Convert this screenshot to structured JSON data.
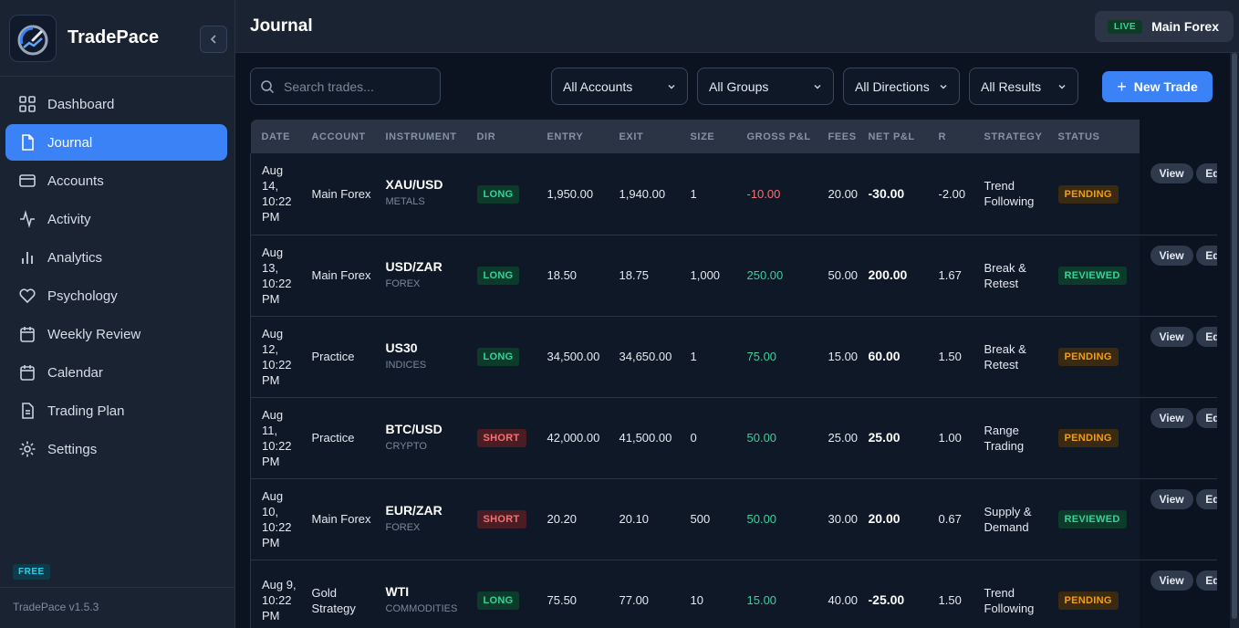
{
  "app": {
    "name": "TradePace",
    "version": "TradePace v1.5.3",
    "plan": "FREE"
  },
  "sidebar": {
    "items": [
      {
        "label": "Dashboard",
        "icon": "grid-icon"
      },
      {
        "label": "Journal",
        "icon": "document-icon",
        "active": true
      },
      {
        "label": "Accounts",
        "icon": "card-icon"
      },
      {
        "label": "Activity",
        "icon": "pulse-icon"
      },
      {
        "label": "Analytics",
        "icon": "bar-chart-icon"
      },
      {
        "label": "Psychology",
        "icon": "heart-icon"
      },
      {
        "label": "Weekly Review",
        "icon": "calendar-icon"
      },
      {
        "label": "Calendar",
        "icon": "calendar-icon"
      },
      {
        "label": "Trading Plan",
        "icon": "file-text-icon"
      },
      {
        "label": "Settings",
        "icon": "gear-icon"
      }
    ]
  },
  "header": {
    "title": "Journal",
    "live_label": "LIVE",
    "account": "Main Forex"
  },
  "filters": {
    "search_placeholder": "Search trades...",
    "accounts": "All Accounts",
    "groups": "All Groups",
    "directions": "All Directions",
    "results": "All Results",
    "new_trade": "New Trade"
  },
  "table": {
    "columns": [
      "DATE",
      "ACCOUNT",
      "INSTRUMENT",
      "DIR",
      "ENTRY",
      "EXIT",
      "SIZE",
      "GROSS P&L",
      "FEES",
      "NET P&L",
      "R",
      "STRATEGY",
      "STATUS"
    ],
    "action_view": "View",
    "action_edit": "Ed",
    "rows": [
      {
        "date": "Aug 14, 10:22 PM",
        "account": "Main Forex",
        "instrument": "XAU/USD",
        "category": "METALS",
        "dir": "LONG",
        "entry": "1,950.00",
        "exit": "1,940.00",
        "size": "1",
        "gross": "-10.00",
        "fees": "20.00",
        "net": "-30.00",
        "r": "-2.00",
        "strategy": "Trend Following",
        "status": "PENDING"
      },
      {
        "date": "Aug 13, 10:22 PM",
        "account": "Main Forex",
        "instrument": "USD/ZAR",
        "category": "FOREX",
        "dir": "LONG",
        "entry": "18.50",
        "exit": "18.75",
        "size": "1,000",
        "gross": "250.00",
        "fees": "50.00",
        "net": "200.00",
        "r": "1.67",
        "strategy": "Break & Retest",
        "status": "REVIEWED"
      },
      {
        "date": "Aug 12, 10:22 PM",
        "account": "Practice",
        "instrument": "US30",
        "category": "INDICES",
        "dir": "LONG",
        "entry": "34,500.00",
        "exit": "34,650.00",
        "size": "1",
        "gross": "75.00",
        "fees": "15.00",
        "net": "60.00",
        "r": "1.50",
        "strategy": "Break & Retest",
        "status": "PENDING"
      },
      {
        "date": "Aug 11, 10:22 PM",
        "account": "Practice",
        "instrument": "BTC/USD",
        "category": "CRYPTO",
        "dir": "SHORT",
        "entry": "42,000.00",
        "exit": "41,500.00",
        "size": "0",
        "gross": "50.00",
        "fees": "25.00",
        "net": "25.00",
        "r": "1.00",
        "strategy": "Range Trading",
        "status": "PENDING"
      },
      {
        "date": "Aug 10, 10:22 PM",
        "account": "Main Forex",
        "instrument": "EUR/ZAR",
        "category": "FOREX",
        "dir": "SHORT",
        "entry": "20.20",
        "exit": "20.10",
        "size": "500",
        "gross": "50.00",
        "fees": "30.00",
        "net": "20.00",
        "r": "0.67",
        "strategy": "Supply & Demand",
        "status": "REVIEWED"
      },
      {
        "date": "Aug 9, 10:22 PM",
        "account": "Gold Strategy",
        "instrument": "WTI",
        "category": "COMMODITIES",
        "dir": "LONG",
        "entry": "75.50",
        "exit": "77.00",
        "size": "10",
        "gross": "15.00",
        "fees": "40.00",
        "net": "-25.00",
        "r": "1.50",
        "strategy": "Trend Following",
        "status": "PENDING"
      }
    ]
  },
  "colors": {
    "accent": "#3b82f6",
    "positive": "#34d399",
    "negative": "#f87171",
    "pending": "#f59e0b"
  }
}
